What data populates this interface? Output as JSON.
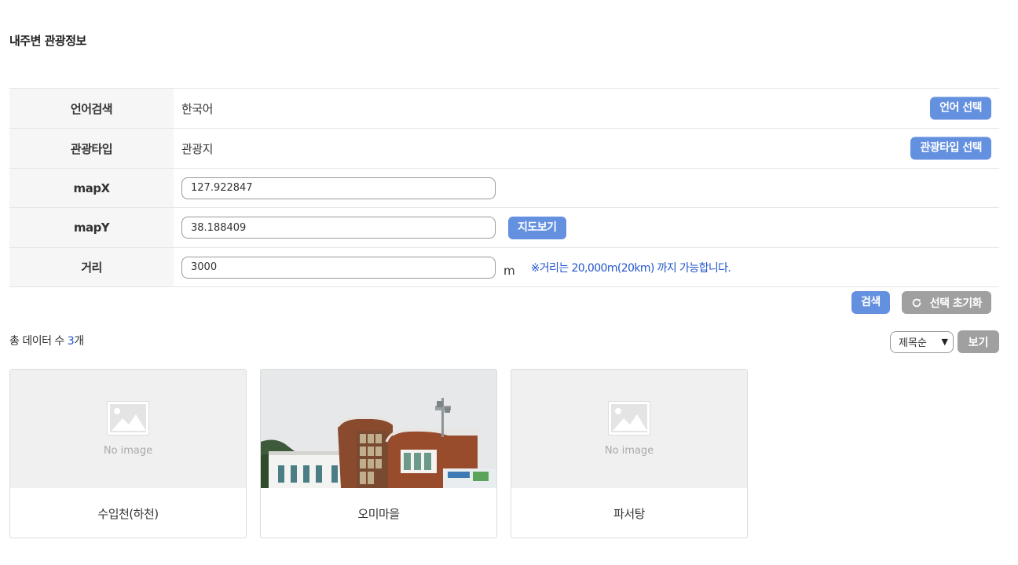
{
  "page_title": "내주변 관광정보",
  "form": {
    "language": {
      "label": "언어검색",
      "value": "한국어",
      "button": "언어 선택"
    },
    "tour_type": {
      "label": "관광타입",
      "value": "관광지",
      "button": "관광타입 선택"
    },
    "map_x": {
      "label": "mapX",
      "value": "127.922847"
    },
    "map_y": {
      "label": "mapY",
      "value": "38.188409",
      "button": "지도보기"
    },
    "distance": {
      "label": "거리",
      "value": "3000",
      "unit": "m",
      "note": "※거리는 20,000m(20km) 까지 가능합니다."
    }
  },
  "actions": {
    "search": "검색",
    "reset": "선택 초기화"
  },
  "results": {
    "count_prefix": "총 데이터 수 ",
    "count": "3",
    "count_suffix": "개"
  },
  "sort": {
    "selected": "제목순",
    "view_button": "보기"
  },
  "cards": [
    {
      "title": "수입천(하천)",
      "image": "none",
      "noimage_text": "No image"
    },
    {
      "title": "오미마을",
      "image": "photo"
    },
    {
      "title": "파서탕",
      "image": "none",
      "noimage_text": "No image"
    }
  ],
  "icons": {
    "reset": "refresh-icon",
    "sort_arrow": "caret-down-icon",
    "noimage": "image-placeholder-icon"
  },
  "colors": {
    "accent": "#6490e0",
    "secondary": "#a0a0a0",
    "note": "#2255cc"
  }
}
